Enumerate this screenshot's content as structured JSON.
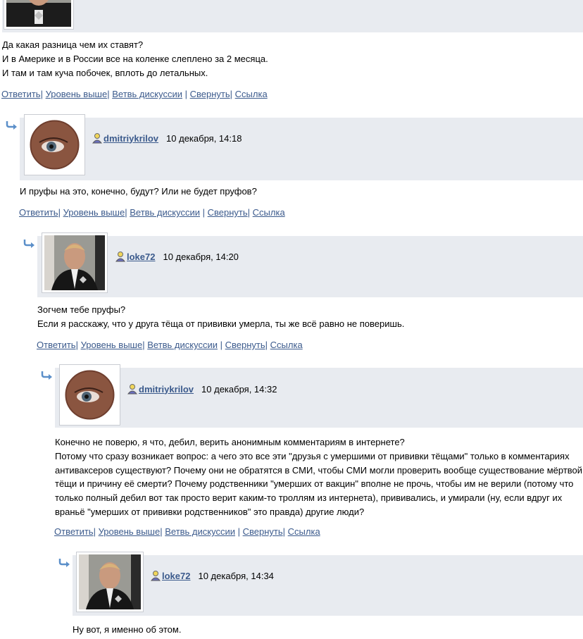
{
  "colors": {
    "link": "#3b5a8c",
    "header_bg": "#e8ebf0",
    "arrow": "#5b8fc9"
  },
  "actions": {
    "reply": "Ответить",
    "level_up": "Уровень выше",
    "branch": "Ветвь дискуссии",
    "collapse": "Свернуть",
    "link": "Ссылка"
  },
  "comments": [
    {
      "text": "Да какая разница чем их ставят?\nИ в Америке и в России все на коленке слеплено за 2 месяца.\nИ там и там куча побочек, вплоть до летальных."
    },
    {
      "author": "dmitriykrilov",
      "date": "10 декабря, 14:18",
      "avatar": "eye-avatar",
      "text": "И пруфы на это, конечно, будут? Или не будет пруфов?"
    },
    {
      "author": "loke72",
      "date": "10 декабря, 14:20",
      "avatar": "man-photo-avatar",
      "text": "Зогчем тебе пруфы?\nЕсли я расскажу, что у друга тёща от прививки умерла, ты же всё равно не поверишь."
    },
    {
      "author": "dmitriykrilov",
      "date": "10 декабря, 14:32",
      "avatar": "eye-avatar",
      "text": "Конечно не поверю, я что, дебил, верить анонимным комментариям в интернете?\nПотому что сразу возникает вопрос: а чего это все эти \"друзья с умершими от прививки тёщами\" только в комментариях\nантиваксеров существуют? Почему они не обратятся в СМИ, чтобы СМИ могли проверить вообще существование мёртвой\nтёщи и причину её смерти? Почему родственники \"умерших от вакцин\" вполне не прочь, чтобы им не верили (потому что\nтолько полный дебил вот так просто верит каким-то троллям из интернета), прививались, и умирали (ну, если вдруг их\nвраньё \"умерших от прививки родственников\" это правда) другие люди?"
    },
    {
      "author": "loke72",
      "date": "10 декабря, 14:34",
      "avatar": "man-photo-avatar",
      "text": "Ну вот, я именно об этом."
    }
  ]
}
